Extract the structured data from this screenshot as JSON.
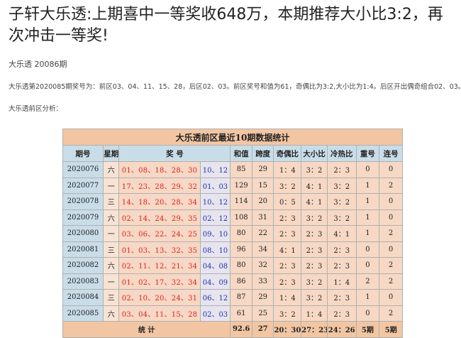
{
  "article": {
    "title": "子轩大乐透:上期喜中一等奖收648万，本期推荐大小比3:2，再次冲击一等奖!",
    "subtitle": "大乐透 20086期",
    "summary": "大乐透第2020085期奖号为：前区03、04、11、15、28，后区02、03。前区奖号和值为61，奇偶比为3:2,大小比为1:4。后区开出偶奇组合02、03。",
    "analysis_label": "大乐透前区分析："
  },
  "table": {
    "caption": "大乐透前区最近10期数据统计",
    "headers": [
      "期号",
      "星期",
      "奖 号",
      "和值",
      "跨度",
      "奇偶比",
      "大小比",
      "冷热比",
      "重号",
      "连号"
    ],
    "rows": [
      {
        "issue": "2020076",
        "week": "六",
        "front": "01、08、18、28、30",
        "back": "10、12",
        "sum": "85",
        "span": "29",
        "odd_even": "1：4",
        "big_small": "3：2",
        "cold_hot": "2：3",
        "repeat": "0",
        "consecutive": "0"
      },
      {
        "issue": "2020077",
        "week": "一",
        "front": "17、23、28、29、32",
        "back": "01、03",
        "sum": "129",
        "span": "15",
        "odd_even": "3：2",
        "big_small": "4：1",
        "cold_hot": "3：2",
        "repeat": "1",
        "consecutive": "2"
      },
      {
        "issue": "2020078",
        "week": "三",
        "front": "14、18、20、28、34",
        "back": "10、12",
        "sum": "114",
        "span": "20",
        "odd_even": "0：5",
        "big_small": "4：1",
        "cold_hot": "3：2",
        "repeat": "1",
        "consecutive": "0"
      },
      {
        "issue": "2020079",
        "week": "六",
        "front": "02、14、24、29、35",
        "back": "02、12",
        "sum": "108",
        "span": "31",
        "odd_even": "2：3",
        "big_small": "3：2",
        "cold_hot": "3：2",
        "repeat": "1",
        "consecutive": "0"
      },
      {
        "issue": "2020080",
        "week": "一",
        "front": "03、06、22、24、25",
        "back": "09、10",
        "sum": "80",
        "span": "22",
        "odd_even": "2：3",
        "big_small": "2：3",
        "cold_hot": "4：1",
        "repeat": "1",
        "consecutive": "2"
      },
      {
        "issue": "2020081",
        "week": "三",
        "front": "01、03、13、32、35",
        "back": "08、10",
        "sum": "96",
        "span": "34",
        "odd_even": "4：1",
        "big_small": "2：3",
        "cold_hot": "2：3",
        "repeat": "0",
        "consecutive": "0"
      },
      {
        "issue": "2020082",
        "week": "六",
        "front": "02、11、12、21、34",
        "back": "04、08",
        "sum": "80",
        "span": "32",
        "odd_even": "2：3",
        "big_small": "2：3",
        "cold_hot": "2：3",
        "repeat": "0",
        "consecutive": "2"
      },
      {
        "issue": "2020083",
        "week": "一",
        "front": "01、02、17、32、34",
        "back": "04、09",
        "sum": "86",
        "span": "33",
        "odd_even": "2：3",
        "big_small": "3：2",
        "cold_hot": "1：4",
        "repeat": "2",
        "consecutive": "2"
      },
      {
        "issue": "2020084",
        "week": "三",
        "front": "02、10、20、24、31",
        "back": "06、12",
        "sum": "87",
        "span": "29",
        "odd_even": "1：4",
        "big_small": "3：2",
        "cold_hot": "2：3",
        "repeat": "1",
        "consecutive": "0"
      },
      {
        "issue": "2020085",
        "week": "六",
        "front": "03、04、11、15、28",
        "back": "02、03",
        "sum": "61",
        "span": "25",
        "odd_even": "3：2",
        "big_small": "1：4",
        "cold_hot": "2：3",
        "repeat": "0",
        "consecutive": "2"
      }
    ],
    "total": {
      "label": "统 计",
      "sum": "92.6",
      "span": "27",
      "odd_even": "20：30",
      "big_small": "27：23",
      "cold_hot": "24：26",
      "repeat": "5期",
      "consecutive": "5期"
    }
  }
}
